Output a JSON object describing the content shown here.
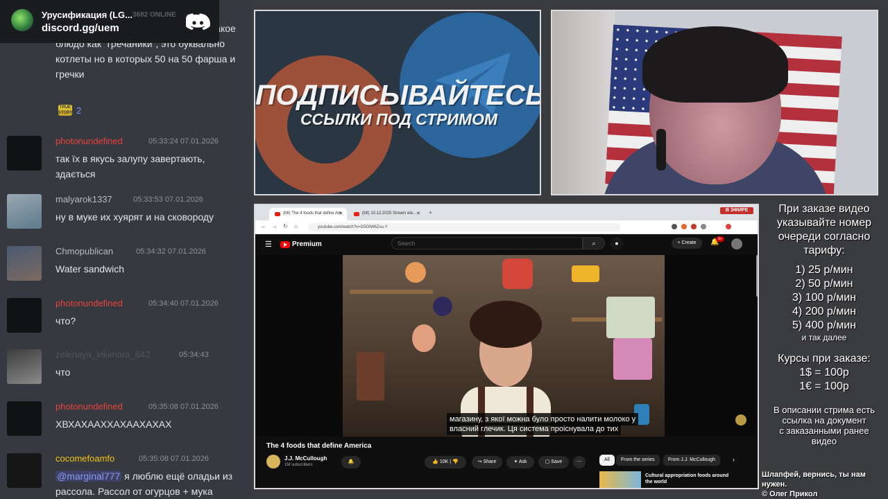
{
  "discord": {
    "server_name": "Урусификация (LG...",
    "online": "3682 ONLINE",
    "invite": "discord.gg/uem"
  },
  "chat": {
    "first_fragment": "тоже фарш добавляют, у нас есть такое блюдо как \"гречаники\", это буквально котлеты но в которых 50 на 50 фарша и гречки",
    "reaction": {
      "emoji": "TRUE STORY",
      "count": "2"
    },
    "messages": [
      {
        "user": "photonundefined",
        "time": "05:33:24 07.01.2026",
        "text": "так їх в якусь залупу завертають, здається",
        "color": "#e8433c",
        "avatar": "mask-icon"
      },
      {
        "user": "malyarok1337",
        "time": "05:33:53 07.01.2026",
        "text": "ну в муке их хуярят и на сковороду",
        "color": "#b9bbbe",
        "avatar": "rat-icon"
      },
      {
        "user": "Chmopublican",
        "time": "05:34:32 07.01.2026",
        "text": "Water sandwich",
        "color": "#b9bbbe",
        "avatar": "suit-icon"
      },
      {
        "user": "photonundefined",
        "time": "05:34:40 07.01.2026",
        "text": "что?",
        "color": "#e8433c",
        "avatar": "mask-icon"
      },
      {
        "user": "zelenaya_kikimora_642",
        "time": "05:34:43",
        "text": "что",
        "color": "#4f545c",
        "avatar": "girl-icon"
      },
      {
        "user": "photonundefined",
        "time": "05:35:08 07.01.2026",
        "text": "ХВХАХААХХАХААХАХАХ",
        "color": "#e8433c",
        "avatar": "mask-icon"
      },
      {
        "user": "cocomefoamfo",
        "time": "05:35:08 07.01.2026",
        "mention": "@marginal777",
        "text": " я люблю ещё оладьи из рассола. Рассол от огурцов + мука",
        "color": "#f1c40f",
        "avatar": "helmet-icon"
      }
    ]
  },
  "promo": {
    "headline": "ПОДПИСЫВАЙТЕСЬ",
    "subline": "ССЫЛКИ ПОД СТРИМОМ"
  },
  "browser": {
    "live_badge": "В ЭФИРЕ",
    "tabs": [
      "(MI) The 4 foods that define Am",
      "(MI) 10.12.2025 Stream ele..."
    ],
    "url": "youtube.com/watch?v=G5OIW6Zsu-Y",
    "search_placeholder": "Search",
    "logo_text": "Premium",
    "create_label": "+ Create",
    "notif_count": "9+",
    "captions": [
      "магазину, з якої можна було просто налити молоко у",
      "власний глечик. Ця система проіснувала до тих"
    ],
    "video_title": "The 4 foods that define America",
    "channel": "J.J. McCullough",
    "subscribers": "1M subscribers",
    "like_count": "10K",
    "share_label": "Share",
    "ask_label": "Ask",
    "save_label": "Save",
    "chips": [
      "All",
      "From the series",
      "From J.J. McCullough"
    ],
    "recommended_title": "Cultural appropriation foods around the world"
  },
  "info": {
    "order_lines": [
      "При заказе видео",
      "указывайте номер",
      "очереди согласно",
      "тарифу:"
    ],
    "tariffs": [
      "1) 25 р/мин",
      "2) 50 р/мин",
      "3) 100 р/мин",
      "4) 200 р/мин",
      "5) 400 р/мин"
    ],
    "tariff_more": "и так далее",
    "rates_title": "Курсы при заказе:",
    "rates": [
      "1$ = 100р",
      "1€ = 100р"
    ],
    "doc_lines": [
      "В описании стрима есть",
      "ссылка на документ",
      "с заказанными ранее",
      "видео"
    ]
  },
  "footer": {
    "line1": "Шлапфей, вернись, ты нам нужен.",
    "line2": "© Олег Прикол"
  }
}
